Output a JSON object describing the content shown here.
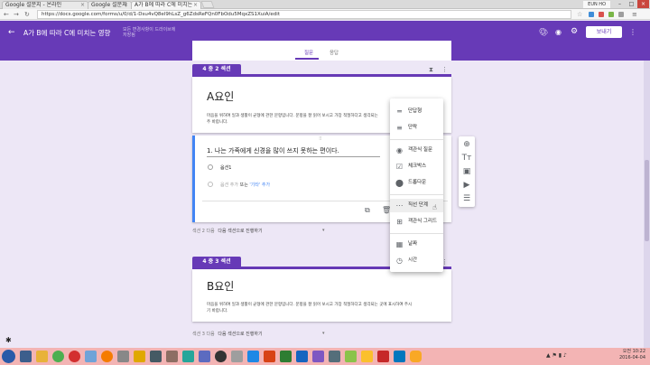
{
  "browser": {
    "tabs": [
      {
        "title": "Google 설문지 - 온라인"
      },
      {
        "title": "Google 설문지"
      },
      {
        "title": "A가 B에 따라 C에 미치는"
      }
    ],
    "user_name": "EUN HO",
    "url": "https://docs.google.com/forms/u/0/d/1-Dsu4vQ8el9hLsZ_g6ZdsReFQn0FbOdu5MqxZS1XuiA/edit"
  },
  "form": {
    "title": "A가 B에 따라 C에 미치는 영향",
    "save_note_line1": "모든 변경사항이 드라이브에",
    "save_note_line2": "저장됨",
    "send_label": "보내기",
    "tabs": [
      "질문",
      "응답"
    ],
    "accent": "#673ab7"
  },
  "section2": {
    "badge": "4 중 2 섹션",
    "title": "A요인",
    "description": "마음을 위하여 일과 생활이 균형에 관한 문항입니다. 문항을 잘 읽어 보시고 가장 적절하다고 생각되는",
    "description2": "주 바랍니다.",
    "question_title": "1. 나는 가족에게 신경을 많이 쓰지 못하는 편이다.",
    "option1": "옵션1",
    "add_option": "옵션 추가",
    "or_label": "또는",
    "add_other": "'기타' 추가",
    "after_section_label": "섹션 2 다음",
    "after_section_value": "다음 섹션으로 진행하기"
  },
  "section3": {
    "badge": "4 중 3 섹션",
    "title": "B요인",
    "description": "마음을 위하여 일과 생활이 균형에 관한 문항입니다. 문항을 잘 읽어 보시고 가장 적절하다고 생각되는 곳에 표시하여 주시",
    "description2": "기 바랍니다.",
    "after_section_label": "섹션 3 다음",
    "after_section_value": "다음 섹션으로 진행하기"
  },
  "type_menu": {
    "items": [
      {
        "label": "단답형",
        "icon": "short-text-icon"
      },
      {
        "label": "단락",
        "icon": "paragraph-icon"
      },
      {
        "label": "객관식 질문",
        "icon": "radio-icon"
      },
      {
        "label": "체크박스",
        "icon": "checkbox-icon"
      },
      {
        "label": "드롭다운",
        "icon": "dropdown-icon"
      },
      {
        "label": "직선 단계",
        "icon": "linear-scale-icon"
      },
      {
        "label": "객관식 그리드",
        "icon": "grid-icon"
      },
      {
        "label": "날짜",
        "icon": "date-icon"
      },
      {
        "label": "시간",
        "icon": "time-icon"
      }
    ]
  },
  "taskbar": {
    "time": "오전 10:22",
    "date": "2016-04-04"
  }
}
